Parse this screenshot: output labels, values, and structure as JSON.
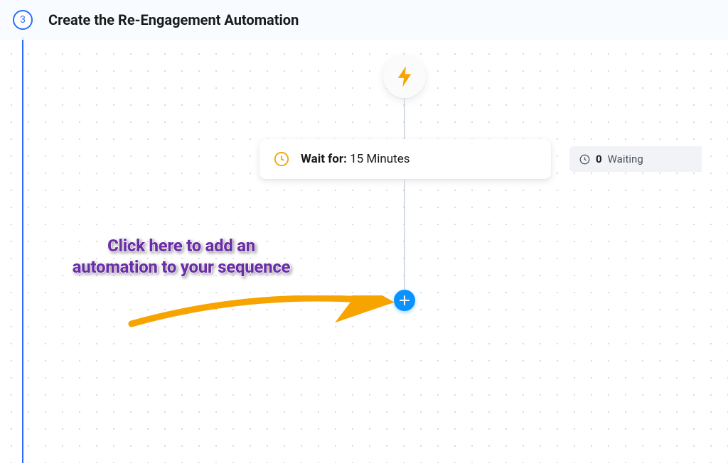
{
  "step": {
    "number": "3",
    "title": "Create the Re-Engagement Automation"
  },
  "wait_node": {
    "prefix": "Wait for:",
    "value": "15 Minutes"
  },
  "status": {
    "count": "0",
    "label": "Waiting"
  },
  "annotation": {
    "text": "Click here to add an automation to your sequence"
  },
  "colors": {
    "accent_blue": "#2f6bff",
    "icon_orange": "#f7a400",
    "add_button": "#0a92ff",
    "annotation_purple": "#6a2fa7"
  }
}
